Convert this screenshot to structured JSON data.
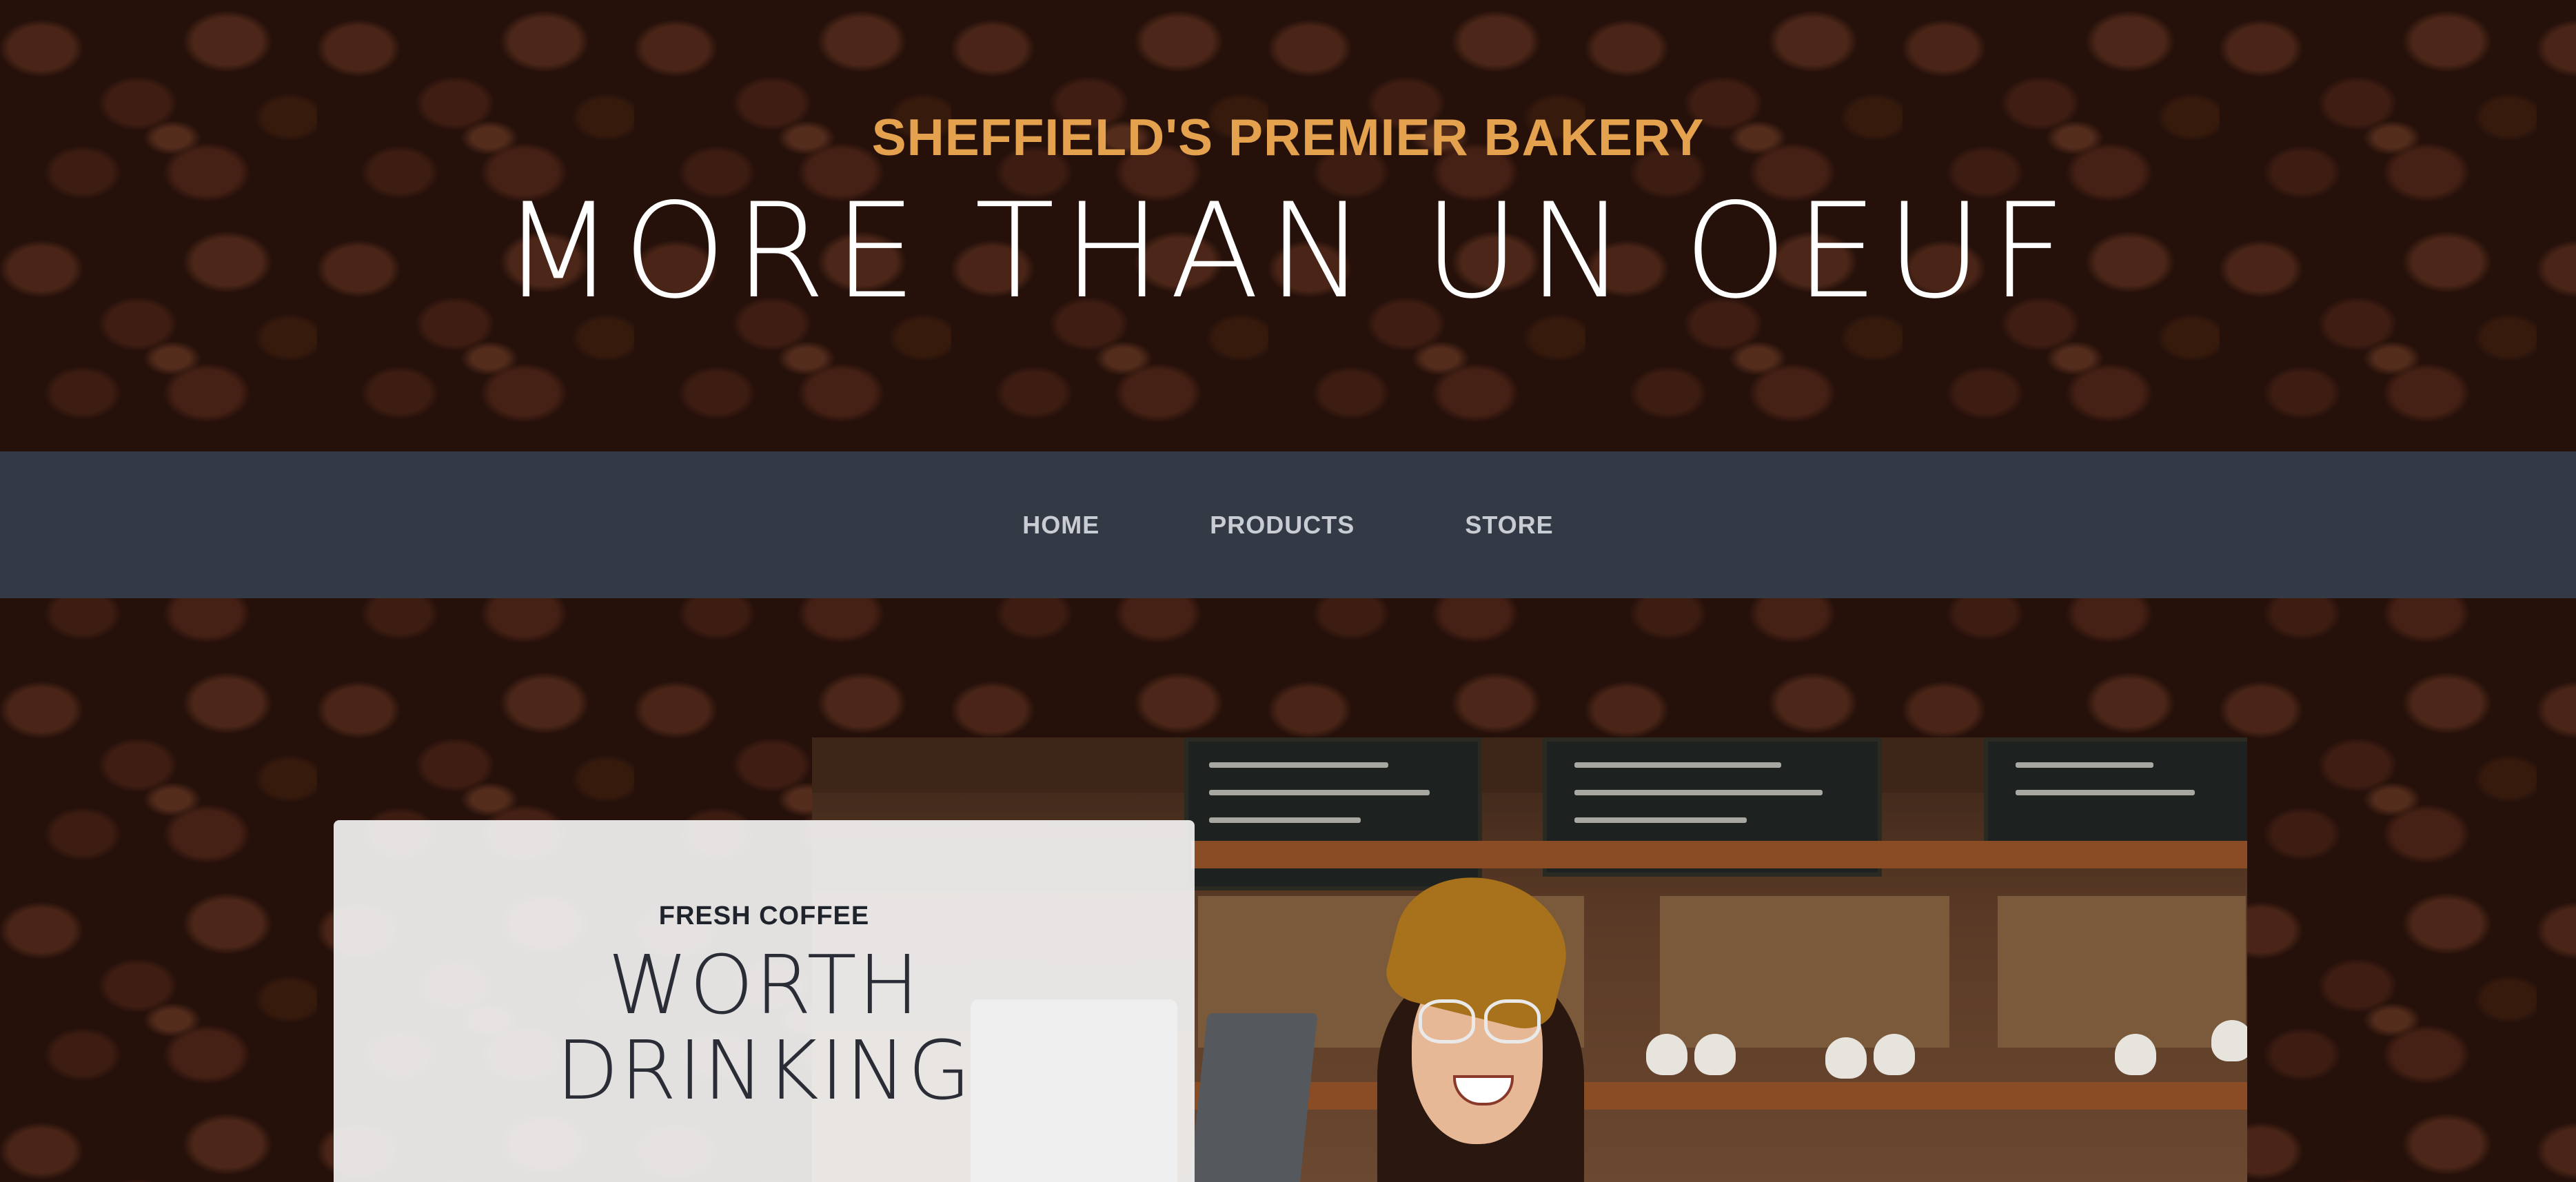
{
  "hero": {
    "upper": "SHEFFIELD'S PREMIER BAKERY",
    "lower": "MORE THAN UN OEUF"
  },
  "nav": {
    "items": [
      {
        "label": "HOME"
      },
      {
        "label": "PRODUCTS"
      },
      {
        "label": "STORE"
      }
    ]
  },
  "intro": {
    "upper": "FRESH COFFEE",
    "lower_line1": "WORTH",
    "lower_line2": "DRINKING"
  },
  "colors": {
    "accent": "#e4a24f",
    "navbar": "#343a45",
    "nav_text": "#c9ccd2",
    "card_bg": "#f3f3f3"
  }
}
